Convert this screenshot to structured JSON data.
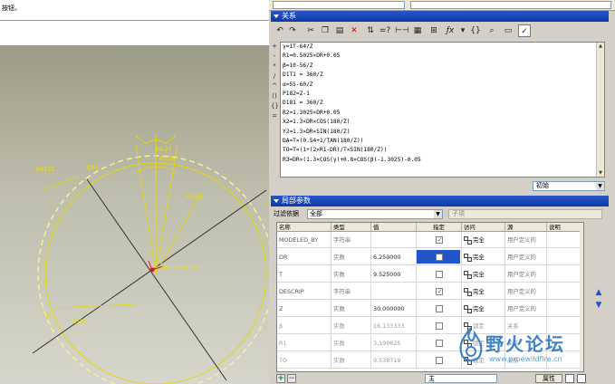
{
  "left": {
    "hint_text": "按钮。"
  },
  "cad": {
    "labels": [
      {
        "text": "Ø81TZ"
      },
      {
        "text": "Ø81"
      },
      {
        "text": "R4.27"
      },
      {
        "text": "R0.55"
      },
      {
        "text": "R0.75"
      },
      {
        "text": "PRT_CSYS_DEF"
      },
      {
        "text": "TOP"
      },
      {
        "text": "DTM1"
      }
    ]
  },
  "relations": {
    "title": "关系",
    "lines": [
      "γ=1T-64/Z",
      "R1=0.5025×DR+0.05",
      "β=10-56/Z",
      "D1T1 = 360/Z",
      "α=55-60/Z",
      "P182=Z-1",
      "D181 = 360/Z",
      "R2=1.3025×DR+0.05",
      "X2=1.3×DR×COS(180/Z)",
      "Y2=1.3×DR×SIN(180/Z)",
      "DA=T×(0.54+1/TAN(180/Z))",
      "TO=T×(1+(2×R1-DR)/T×SIN(180/Z))",
      "R3=DR×(1.3×COS(γ)+0.8×COS(β)-1.3025)-0.05"
    ],
    "side_ops": [
      "+",
      "-",
      "*",
      "/",
      "^",
      "()",
      "{}",
      "="
    ],
    "toolbar_icons": [
      "undo-icon",
      "redo-icon",
      "cut-icon",
      "copy-icon",
      "paste-icon",
      "delete-icon",
      "sort-icon",
      "verify-icon",
      "measure-icon",
      "insert-icon",
      "parameters-icon",
      "function-icon",
      "braces-icon",
      "evaluate-icon",
      "local-params-icon",
      "checkbox-icon"
    ],
    "unit_select": "初始"
  },
  "params": {
    "title": "局部参数",
    "filter_label": "过滤依据",
    "filter_value": "全部",
    "sub_select": "子项",
    "headers": [
      "名称",
      "类型",
      "值",
      "指定",
      "访问",
      "源",
      "说明"
    ],
    "rows": [
      {
        "name": "MODELED_BY",
        "type": "字符串",
        "value": "",
        "designated": true,
        "access": "完全",
        "source": "用户定义的",
        "desc": "",
        "dim": false,
        "selected": false
      },
      {
        "name": "DR",
        "type": "实数",
        "value": "6.250000",
        "designated": false,
        "access": "完全",
        "source": "用户定义的",
        "desc": "",
        "dim": false,
        "selected": true
      },
      {
        "name": "T",
        "type": "实数",
        "value": "9.525000",
        "designated": false,
        "access": "完全",
        "source": "用户定义的",
        "desc": "",
        "dim": false,
        "selected": false
      },
      {
        "name": "DESCRIP",
        "type": "字符串",
        "value": "",
        "designated": true,
        "access": "完全",
        "source": "用户定义的",
        "desc": "",
        "dim": false,
        "selected": false
      },
      {
        "name": "Z",
        "type": "实数",
        "value": "30.000000",
        "designated": false,
        "access": "完全",
        "source": "用户定义的",
        "desc": "",
        "dim": false,
        "selected": false
      },
      {
        "name": "β",
        "type": "实数",
        "value": "16.133333",
        "designated": false,
        "access": "锁定",
        "source": "关系",
        "desc": "",
        "dim": true,
        "selected": false
      },
      {
        "name": "R1",
        "type": "实数",
        "value": "3.190625",
        "designated": false,
        "access": "锁定",
        "source": "关系",
        "desc": "",
        "dim": true,
        "selected": false
      },
      {
        "name": "TO",
        "type": "实数",
        "value": "9.538719",
        "designated": false,
        "access": "锁定",
        "source": "关系",
        "desc": "",
        "dim": true,
        "selected": false
      }
    ],
    "main_select": "主",
    "prop_button": "属性"
  },
  "watermark": {
    "title": "野火论坛",
    "url": "www.proewildfire.cn"
  },
  "colors": {
    "titlebar": "#0c3aa8",
    "cad_yellow": "#f0e000",
    "selection": "#2455c8"
  }
}
